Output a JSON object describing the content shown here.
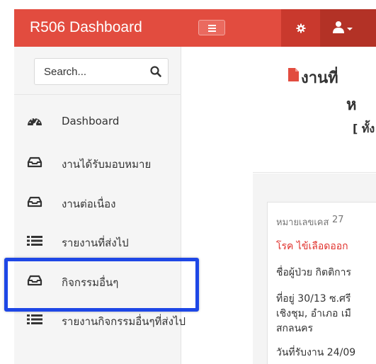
{
  "header": {
    "brand": "R506 Dashboard",
    "menu_icon": "hamburger-icon",
    "gear_icon": "gear-icon",
    "user_icon": "user-icon"
  },
  "sidebar": {
    "search": {
      "placeholder": "Search..."
    },
    "items": [
      {
        "label": "Dashboard",
        "icon": "dashboard-gauge-icon"
      },
      {
        "label": "งานได้รับมอบหมาย",
        "icon": "inbox-icon"
      },
      {
        "label": "งานต่อเนื่อง",
        "icon": "inbox-icon"
      },
      {
        "label": "รายงานที่ส่งไป",
        "icon": "list-icon"
      },
      {
        "label": "กิจกรรมอื่นๆ",
        "icon": "inbox-icon"
      },
      {
        "label": "รายงานกิจกรรมอื่นๆที่ส่งไป",
        "icon": "list-icon"
      }
    ]
  },
  "main": {
    "title_line1": "งานที่",
    "title_line2": "ห",
    "title_line3": "[ ทั้ง",
    "case": {
      "case_no_label": "หมายเลขเคส",
      "case_no": "27",
      "disease": "โรค ไข้เลือดออก",
      "patient": "ชื่อผู้ป่วย กิตติการ",
      "address1": "ที่อยู่ 30/13 ซ.ศรี",
      "address2": "เชิงชุม, อำเภอ เมื",
      "address3": "สกลนคร",
      "date": "วันที่รับงาน 24/09"
    }
  },
  "colors": {
    "header_red": "#e24c3f",
    "header_dark": "#c9392d",
    "highlight_blue": "#1e47e6",
    "disease_red": "#e0302b",
    "file_icon_red": "#e24c3f"
  }
}
